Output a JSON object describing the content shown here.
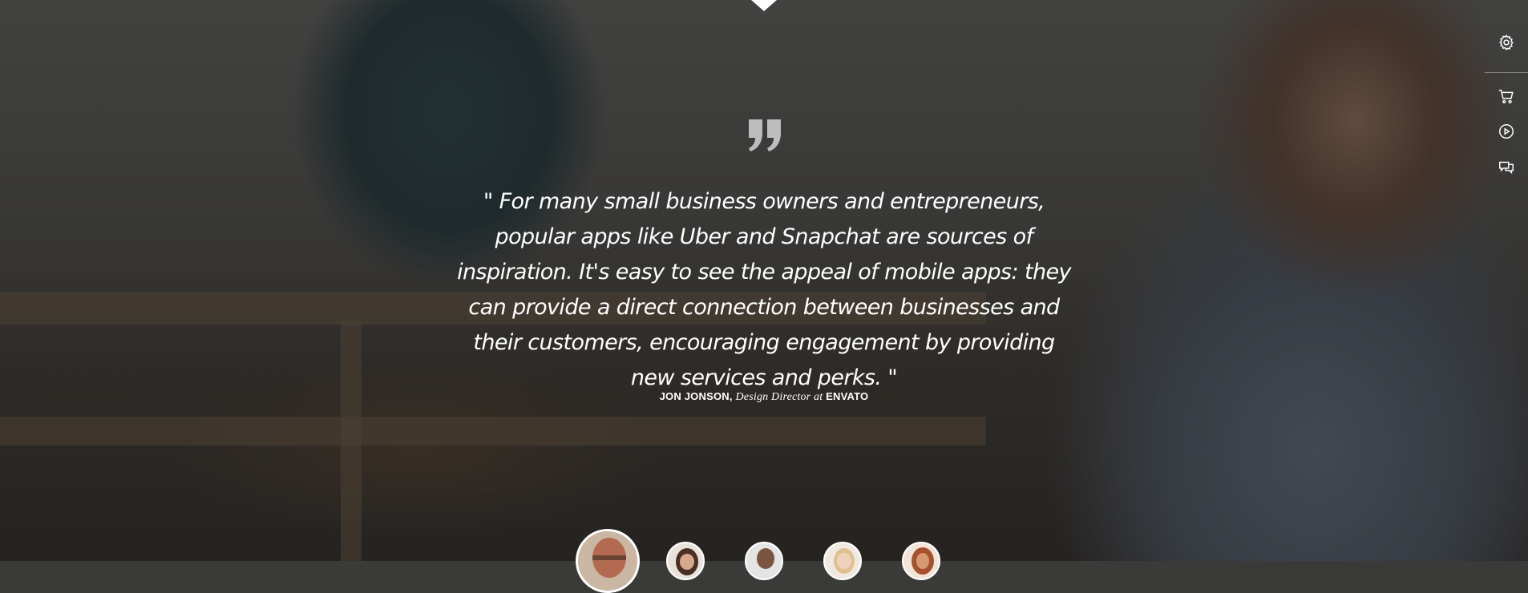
{
  "testimonial": {
    "quote": "\" For many small business owners and entrepreneurs, popular apps like Uber and Snapchat are sources of inspiration. It's easy to see the appeal of mobile apps: they can provide a direct connection between businesses and their customers, encouraging engagement by providing new services and perks. \"",
    "author_name": "JON JONSON,",
    "author_role": "Design Director at",
    "author_company": "ENVATO"
  },
  "sidebar": {
    "items": [
      {
        "icon": "gear-icon"
      },
      {
        "icon": "cart-icon"
      },
      {
        "icon": "play-circle-icon"
      },
      {
        "icon": "chat-bubbles-icon"
      }
    ]
  },
  "avatars": [
    {
      "name": "avatar-1",
      "active": true
    },
    {
      "name": "avatar-2",
      "active": false
    },
    {
      "name": "avatar-3",
      "active": false
    },
    {
      "name": "avatar-4",
      "active": false
    },
    {
      "name": "avatar-5",
      "active": false
    }
  ],
  "colors": {
    "text": "#ffffff",
    "overlay": "#141414"
  }
}
